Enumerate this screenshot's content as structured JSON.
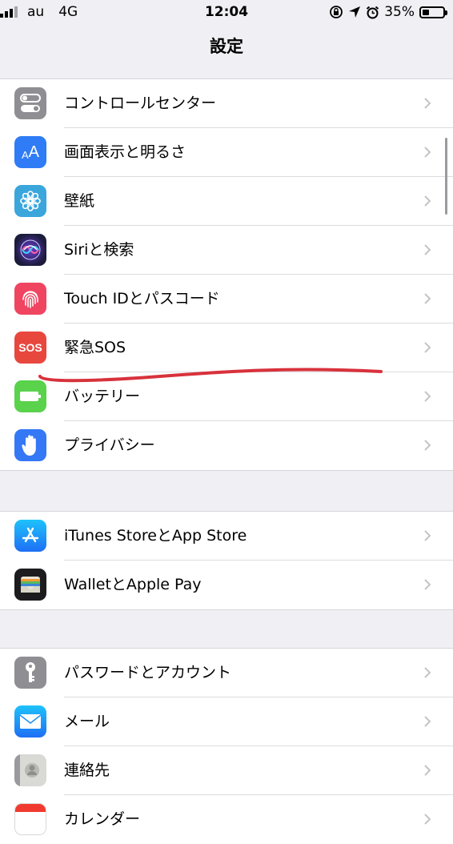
{
  "status": {
    "carrier": "au",
    "network": "4G",
    "time": "12:04",
    "battery": "35%",
    "battery_level": 0.35
  },
  "nav": {
    "title": "設定"
  },
  "groups": [
    {
      "items": [
        {
          "label": "コントロールセンター",
          "icon": "control-center-icon",
          "color": "#8e8e93"
        },
        {
          "label": "画面表示と明るさ",
          "icon": "display-brightness-icon",
          "color": "#2f7cf6"
        },
        {
          "label": "壁紙",
          "icon": "wallpaper-icon",
          "color": "#3aa6dc"
        },
        {
          "label": "Siriと検索",
          "icon": "siri-icon",
          "color": "#1c1c3c"
        },
        {
          "label": "Touch IDとパスコード",
          "icon": "fingerprint-icon",
          "color": "#ef4561"
        },
        {
          "label": "緊急SOS",
          "icon": "sos-icon",
          "icon_text": "SOS",
          "color": "#e8473e"
        },
        {
          "label": "バッテリー",
          "icon": "battery-icon",
          "color": "#5ad24c"
        },
        {
          "label": "プライバシー",
          "icon": "privacy-hand-icon",
          "color": "#3478f6"
        }
      ]
    },
    {
      "items": [
        {
          "label": "iTunes StoreとApp Store",
          "icon": "app-store-icon",
          "color": "#1e90f5"
        },
        {
          "label": "WalletとApple Pay",
          "icon": "wallet-icon",
          "color": "#1c1c1e"
        }
      ]
    },
    {
      "items": [
        {
          "label": "パスワードとアカウント",
          "icon": "key-icon",
          "color": "#8e8e93"
        },
        {
          "label": "メール",
          "icon": "mail-icon",
          "color": "#2a8ef5"
        },
        {
          "label": "連絡先",
          "icon": "contacts-icon",
          "color": "#a3a3a7"
        },
        {
          "label": "カレンダー",
          "icon": "calendar-icon",
          "color": "#ffffff"
        }
      ]
    }
  ]
}
